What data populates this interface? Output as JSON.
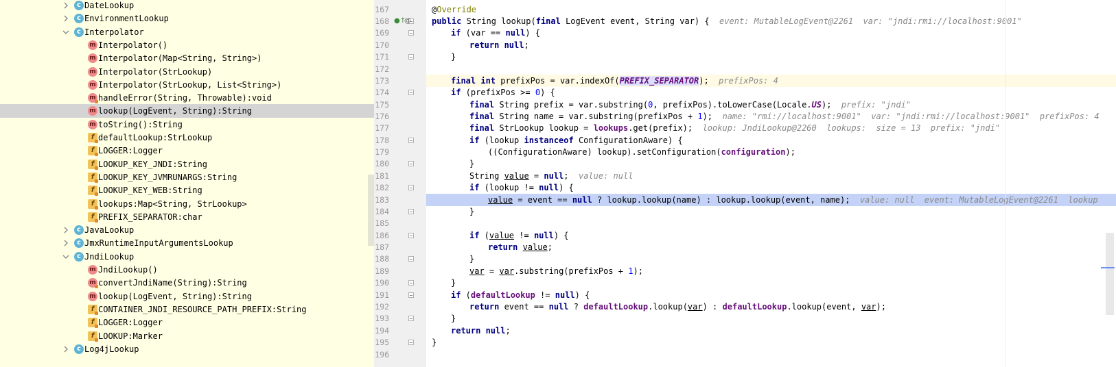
{
  "structure": {
    "rows": [
      {
        "label": "DateLookup",
        "kind": "class",
        "indent": 0,
        "expand": "collapsed"
      },
      {
        "label": "EnvironmentLookup",
        "kind": "class",
        "indent": 0,
        "expand": "collapsed"
      },
      {
        "label": "Interpolator",
        "kind": "class",
        "indent": 0,
        "expand": "expanded"
      },
      {
        "label": "Interpolator()",
        "kind": "method",
        "indent": 1,
        "lock": false
      },
      {
        "label": "Interpolator(Map<String, String>)",
        "kind": "method",
        "indent": 1,
        "lock": false
      },
      {
        "label": "Interpolator(StrLookup)",
        "kind": "method",
        "indent": 1,
        "lock": false
      },
      {
        "label": "Interpolator(StrLookup, List<String>)",
        "kind": "method",
        "indent": 1,
        "lock": false
      },
      {
        "label": "handleError(String, Throwable):void",
        "kind": "method",
        "indent": 1,
        "lock": true
      },
      {
        "label": "lookup(LogEvent, String):String",
        "kind": "method",
        "indent": 1,
        "lock": false,
        "selected": true
      },
      {
        "label": "toString():String",
        "kind": "method",
        "indent": 1,
        "lock": false
      },
      {
        "label": "defaultLookup:StrLookup",
        "kind": "field",
        "indent": 1,
        "lock": true
      },
      {
        "label": "LOGGER:Logger",
        "kind": "field",
        "indent": 1,
        "lock": true
      },
      {
        "label": "LOOKUP_KEY_JNDI:String",
        "kind": "field",
        "indent": 1,
        "lock": true
      },
      {
        "label": "LOOKUP_KEY_JVMRUNARGS:String",
        "kind": "field",
        "indent": 1,
        "lock": true
      },
      {
        "label": "LOOKUP_KEY_WEB:String",
        "kind": "field",
        "indent": 1,
        "lock": true
      },
      {
        "label": "lookups:Map<String, StrLookup>",
        "kind": "field",
        "indent": 1,
        "lock": true
      },
      {
        "label": "PREFIX_SEPARATOR:char",
        "kind": "field",
        "indent": 1,
        "lock": true
      },
      {
        "label": "JavaLookup",
        "kind": "class",
        "indent": 0,
        "expand": "collapsed"
      },
      {
        "label": "JmxRuntimeInputArgumentsLookup",
        "kind": "class",
        "indent": 0,
        "expand": "collapsed"
      },
      {
        "label": "JndiLookup",
        "kind": "class",
        "indent": 0,
        "expand": "expanded"
      },
      {
        "label": "JndiLookup()",
        "kind": "method",
        "indent": 1,
        "lock": false
      },
      {
        "label": "convertJndiName(String):String",
        "kind": "method",
        "indent": 1,
        "lock": true
      },
      {
        "label": "lookup(LogEvent, String):String",
        "kind": "method",
        "indent": 1,
        "lock": false
      },
      {
        "label": "CONTAINER_JNDI_RESOURCE_PATH_PREFIX:String",
        "kind": "field",
        "indent": 1,
        "lock": true
      },
      {
        "label": "LOGGER:Logger",
        "kind": "field",
        "indent": 1,
        "lock": true
      },
      {
        "label": "LOOKUP:Marker",
        "kind": "field",
        "indent": 1,
        "lock": true
      },
      {
        "label": "Log4jLookup",
        "kind": "class",
        "indent": 0,
        "expand": "collapsed"
      }
    ]
  },
  "editor": {
    "line_numbers": [
      "167",
      "168",
      "169",
      "170",
      "171",
      "172",
      "173",
      "174",
      "175",
      "176",
      "177",
      "178",
      "179",
      "180",
      "181",
      "182",
      "183",
      "184",
      "185",
      "186",
      "187",
      "188",
      "189",
      "190",
      "191",
      "192",
      "193",
      "194",
      "195",
      "196"
    ],
    "inlay": {
      "l168": "event: MutableLogEvent@2261  var: \"jndi:rmi://localhost:9001\"",
      "l173": "prefixPos: 4",
      "l175": "prefix: \"jndi\"",
      "l176": "name: \"rmi://localhost:9001\"  var: \"jndi:rmi://localhost:9001\"  prefixPos: 4",
      "l177": "lookup: JndiLookup@2260  lookups:  size = 13  prefix: \"jndi\"",
      "l181": "value: null",
      "l183": "value: null  event: MutableLogEvent@2261  lookup"
    }
  },
  "colors": {
    "structure_bg": "#ffffe4",
    "selected_row": "#d4d4d4",
    "caret_line": "#fffae3",
    "execution_line": "#c3d2f6",
    "keyword": "#000080",
    "field": "#660e7a",
    "annotation": "#808000",
    "number": "#0000ff",
    "string": "#008000"
  }
}
